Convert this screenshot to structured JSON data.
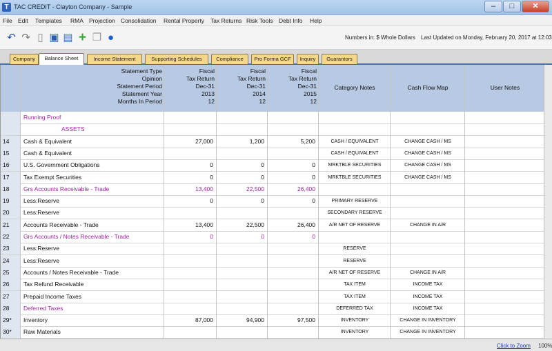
{
  "window": {
    "title": "TAC CREDIT - Clayton Company - Sample",
    "min": "–",
    "max": "□",
    "close": "✕"
  },
  "menu": [
    "File",
    "Edit",
    "Templates",
    "RMA",
    "Projection",
    "Consolidation",
    "Rental Property",
    "Tax Returns",
    "Risk Tools",
    "Debt Info",
    "Help"
  ],
  "toolbar": {
    "numbers": "Numbers in: $ Whole Dollars",
    "updated": "Last Updated on Monday, February 20, 2017 at 12:03 PM"
  },
  "tabs": [
    "Company",
    "Balance Sheet",
    "Income Statement",
    "Supporting Schedules",
    "Compliance",
    "Pro Forma GCF",
    "Inquiry",
    "Guarantors"
  ],
  "header": {
    "labels": [
      "Statement Type",
      "Opinion",
      "Statement Period",
      "Statement Year",
      "Months In Period"
    ],
    "columns": [
      [
        "Fiscal",
        "Tax Return",
        "Dec-31",
        "2013",
        "12"
      ],
      [
        "Fiscal",
        "Tax Return",
        "Dec-31",
        "2014",
        "12"
      ],
      [
        "Fiscal",
        "Tax Return",
        "Dec-31",
        "2015",
        "12"
      ]
    ],
    "category": "Category Notes",
    "cashflow": "Cash Flow Map",
    "user": "User Notes"
  },
  "rows": [
    {
      "num": "",
      "label": "Running Proof",
      "v1": "",
      "v2": "",
      "v3": "",
      "cat": "",
      "cf": "",
      "color": "#a020a0",
      "indent": 0
    },
    {
      "num": "",
      "label": "ASSETS",
      "v1": "",
      "v2": "",
      "v3": "",
      "cat": "",
      "cf": "",
      "color": "#a020a0",
      "indent": 55
    },
    {
      "num": "14",
      "label": "Cash & Equivalent",
      "v1": "27,000",
      "v2": "1,200",
      "v3": "5,200",
      "cat": "CASH / EQUIVALENT",
      "cf": "CHANGE CASH / MS",
      "color": "#111",
      "indent": 0
    },
    {
      "num": "15",
      "label": "Cash & Equivalent",
      "v1": "",
      "v2": "",
      "v3": "",
      "cat": "CASH / EQUIVALENT",
      "cf": "CHANGE CASH / MS",
      "color": "#111",
      "indent": 0
    },
    {
      "num": "16",
      "label": "U.S. Government Obligations",
      "v1": "0",
      "v2": "0",
      "v3": "0",
      "cat": "MRKTBLE SECURITIES",
      "cf": "CHANGE CASH / MS",
      "color": "#111",
      "indent": 0
    },
    {
      "num": "17",
      "label": "Tax Exempt Securities",
      "v1": "0",
      "v2": "0",
      "v3": "0",
      "cat": "MRKTBLE SECURITIES",
      "cf": "CHANGE CASH / MS",
      "color": "#111",
      "indent": 0
    },
    {
      "num": "18",
      "label": "Grs Accounts Receivable - Trade",
      "v1": "13,400",
      "v2": "22,500",
      "v3": "26,400",
      "cat": "",
      "cf": "",
      "color": "#a020a0",
      "indent": 0
    },
    {
      "num": "19",
      "label": "Less:Reserve",
      "v1": "0",
      "v2": "0",
      "v3": "0",
      "cat": "PRIMARY RESERVE",
      "cf": "",
      "color": "#111",
      "indent": 0
    },
    {
      "num": "20",
      "label": "Less:Reserve",
      "v1": "",
      "v2": "",
      "v3": "",
      "cat": "SECONDARY RESERVE",
      "cf": "",
      "color": "#111",
      "indent": 0
    },
    {
      "num": "21",
      "label": "Accounts Receivable - Trade",
      "v1": "13,400",
      "v2": "22,500",
      "v3": "26,400",
      "cat": "A/R NET OF RESERVE",
      "cf": "CHANGE IN A/R",
      "color": "#111",
      "indent": 0
    },
    {
      "num": "22",
      "label": "Grs Accounts / Notes Receivable - Trade",
      "v1": "0",
      "v2": "0",
      "v3": "0",
      "cat": "",
      "cf": "",
      "color": "#a020a0",
      "indent": 0
    },
    {
      "num": "23",
      "label": "Less:Reserve",
      "v1": "",
      "v2": "",
      "v3": "",
      "cat": "RESERVE",
      "cf": "",
      "color": "#111",
      "indent": 0
    },
    {
      "num": "24",
      "label": "Less:Reserve",
      "v1": "",
      "v2": "",
      "v3": "",
      "cat": "RESERVE",
      "cf": "",
      "color": "#111",
      "indent": 0
    },
    {
      "num": "25",
      "label": "Accounts / Notes Receivable - Trade",
      "v1": "",
      "v2": "",
      "v3": "",
      "cat": "A/R NET OF RESERVE",
      "cf": "CHANGE IN A/R",
      "color": "#111",
      "indent": 0
    },
    {
      "num": "26",
      "label": "Tax Refund Receivable",
      "v1": "",
      "v2": "",
      "v3": "",
      "cat": "TAX ITEM",
      "cf": "INCOME TAX",
      "color": "#111",
      "indent": 0
    },
    {
      "num": "27",
      "label": "Prepaid Income Taxes",
      "v1": "",
      "v2": "",
      "v3": "",
      "cat": "TAX ITEM",
      "cf": "INCOME TAX",
      "color": "#111",
      "indent": 0
    },
    {
      "num": "28",
      "label": "Deferred Taxes",
      "v1": "",
      "v2": "",
      "v3": "",
      "cat": "DEFERRED TAX",
      "cf": "INCOME TAX",
      "color": "#a020a0",
      "indent": 0
    },
    {
      "num": "29*",
      "label": "Inventory",
      "v1": "87,000",
      "v2": "94,900",
      "v3": "97,500",
      "cat": "INVENTORY",
      "cf": "CHANGE IN INVENTORY",
      "color": "#111",
      "indent": 0
    },
    {
      "num": "30*",
      "label": "Raw Materials",
      "v1": "",
      "v2": "",
      "v3": "",
      "cat": "INVENTORY",
      "cf": "CHANGE IN INVENTORY",
      "color": "#111",
      "indent": 0
    }
  ],
  "status": {
    "zoom_link": "Click to Zoom",
    "zoom_pct": "100%"
  }
}
